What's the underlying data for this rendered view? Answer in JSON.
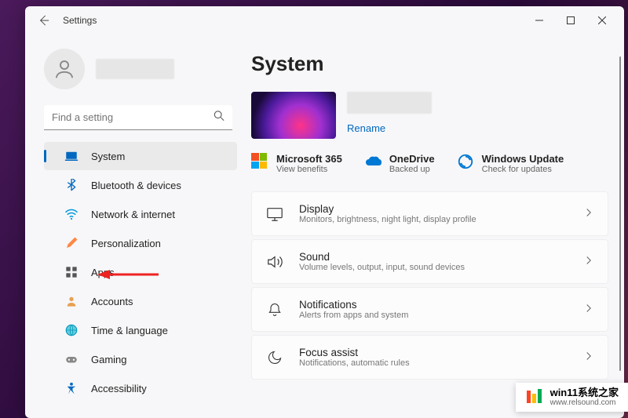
{
  "window": {
    "title": "Settings"
  },
  "search": {
    "placeholder": "Find a setting"
  },
  "nav": {
    "items": [
      {
        "label": "System"
      },
      {
        "label": "Bluetooth & devices"
      },
      {
        "label": "Network & internet"
      },
      {
        "label": "Personalization"
      },
      {
        "label": "Apps"
      },
      {
        "label": "Accounts"
      },
      {
        "label": "Time & language"
      },
      {
        "label": "Gaming"
      },
      {
        "label": "Accessibility"
      }
    ]
  },
  "page": {
    "title": "System",
    "rename": "Rename",
    "status": [
      {
        "title": "Microsoft 365",
        "sub": "View benefits"
      },
      {
        "title": "OneDrive",
        "sub": "Backed up"
      },
      {
        "title": "Windows Update",
        "sub": "Check for updates"
      }
    ],
    "cards": [
      {
        "title": "Display",
        "sub": "Monitors, brightness, night light, display profile"
      },
      {
        "title": "Sound",
        "sub": "Volume levels, output, input, sound devices"
      },
      {
        "title": "Notifications",
        "sub": "Alerts from apps and system"
      },
      {
        "title": "Focus assist",
        "sub": "Notifications, automatic rules"
      }
    ]
  },
  "watermark": {
    "title": "win11系统之家",
    "sub": "www.relsound.com"
  }
}
